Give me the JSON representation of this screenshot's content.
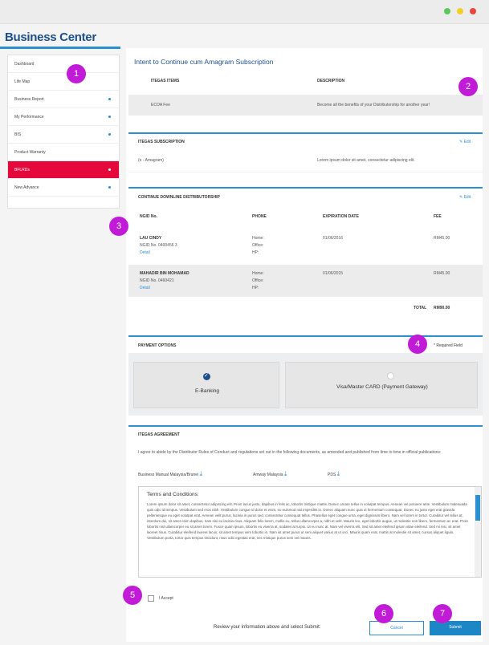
{
  "window": {
    "dot_colors": [
      "#5cc85c",
      "#f2cf22",
      "#e9473b"
    ]
  },
  "brand": "Business Center",
  "sidebar": {
    "items": [
      {
        "label": "Dashboard",
        "has_chevron": false,
        "active": false
      },
      {
        "label": "Life Map",
        "has_chevron": false,
        "active": false
      },
      {
        "label": "Business Report",
        "has_chevron": true,
        "active": false
      },
      {
        "label": "My Performance",
        "has_chevron": true,
        "active": false
      },
      {
        "label": "BIS",
        "has_chevron": true,
        "active": false
      },
      {
        "label": "Product Warranty",
        "has_chevron": false,
        "active": false
      },
      {
        "label": "BFLRDs",
        "has_chevron": true,
        "active": true
      },
      {
        "label": "New Advance",
        "has_chevron": true,
        "active": false
      }
    ]
  },
  "main": {
    "title": "Intent to Continue cum Amagram Subscription",
    "items_table": {
      "headers": [
        "ITEGAS ITEMS",
        "DESCRIPTION"
      ],
      "rows": [
        [
          "ECOA Fee",
          "Become all the benefits of your Distributorship for another year!"
        ]
      ]
    },
    "subscription": {
      "header": "ITEGAS SUBSCRIPTION",
      "edit": "Edit",
      "item": "(e - Amagram)",
      "desc": "Lorem ipsum dolor sit amet, consectetur adipiscing elit."
    },
    "distributorship": {
      "header": "CONTINUE DOWNLINE DISTRIBUTORSHIP",
      "edit": "Edit",
      "columns": [
        "NGID No.",
        "PHONE",
        "EXPIRATION DATE",
        "FEE"
      ],
      "rows": [
        {
          "name": "LAU CINDY",
          "id": "NGID No. 0400456 3",
          "detail": "Detail",
          "phone": [
            "Home:",
            "Office:",
            "HP:"
          ],
          "date": "01/06/2016",
          "fee": "RM45.00"
        },
        {
          "name": "MAHADIR BIN MOHAMAD",
          "id": "NGID No. 0460421",
          "detail": "Detail",
          "phone": [
            "Home:",
            "Office:",
            "HP:"
          ],
          "date": "01/06/2015",
          "fee": "RM45.00"
        }
      ],
      "total_label": "TOTAL",
      "total_value": "RM90.00"
    },
    "payment": {
      "header": "PAYMENT OPTIONS",
      "required": "* Required Field",
      "options": [
        {
          "label": "E-Banking",
          "selected": true
        },
        {
          "label": "Visa/Master CARD (Payment Gateway)",
          "selected": false
        }
      ]
    },
    "agreement": {
      "header": "ITEGAS AGREEMENT",
      "text": "I agree to abide by the Distributor Rules of Conduct and regulations set out in the following documents, as amended and published from time to time in official publications:",
      "docs": [
        "Business Manual Malaysia/Brunei",
        "Amway Malaysia",
        "PDS"
      ],
      "terms_title": "Terms and Conditions:",
      "terms_text": "Lorem ipsum dolor sit amet, consectetur adipiscing elit. Proin lacus justo, dapibus in felis ac, lobortis tristique mattis. Donec ornare tellus in volutpat tempus. Aenean vel posuere ante. Vestibulum malesuada quis odio id tempus. Vestibulum sed eros nibh. Vestibulum congue id dolor et enim, eu euismod nisl imperdiet in. Donec aliquam nunc quis ut fermentum consequat. Donec eu justo eget erat gravida pellentesque eu eget volutpat erat. Aenean velit purus, lacinia in purus sed, consectetur consequat tellus. Phasellus eget congue urna, eget dignissim libero. Nam vel lorem in tortor. Curabitur vel tellus at, interdum dui, sit amet enim dapibus, nam nisi eu lacinia risus. Aliquam felis lorem, mollis eu, tellus ullamcorper a, nibh et velit. Mauris leo, eget lobortis augue, ut molestie non libero, fermentum ac erat. Proin lobortis nisl ullamcorper eu sit amet lorem. Fusce quam ipsum, lobortis eu viverra at, sodales at turpis. Ut eu nunc at. Nam vel viverra elit. Sed sit amet eleifend ipsum vitae eleifend. Sed mi nisi, sit amet laoreet risus. Curabitur eleifend laoreet lacus, sit amet tempus sem lobortis in. Nam sit amet purus ut sem aliquet varius at ut orci. Mauris quam erat, mattis at molestie sit amet, cursus aliquet ligula. Vestibulum porta, tortor quis tempus tincidunt, risus odio egestas erat, nec tristique purus sem vel mauris."
    },
    "accept_label": "I Accept",
    "footer_prompt": "Review your information above and select Submit:",
    "cancel": "Cancel",
    "submit": "Submit",
    "accent": "#2b8fd0",
    "active_color": "#e5083a"
  },
  "badges": [
    "1",
    "2",
    "3",
    "4",
    "5",
    "6",
    "7"
  ]
}
